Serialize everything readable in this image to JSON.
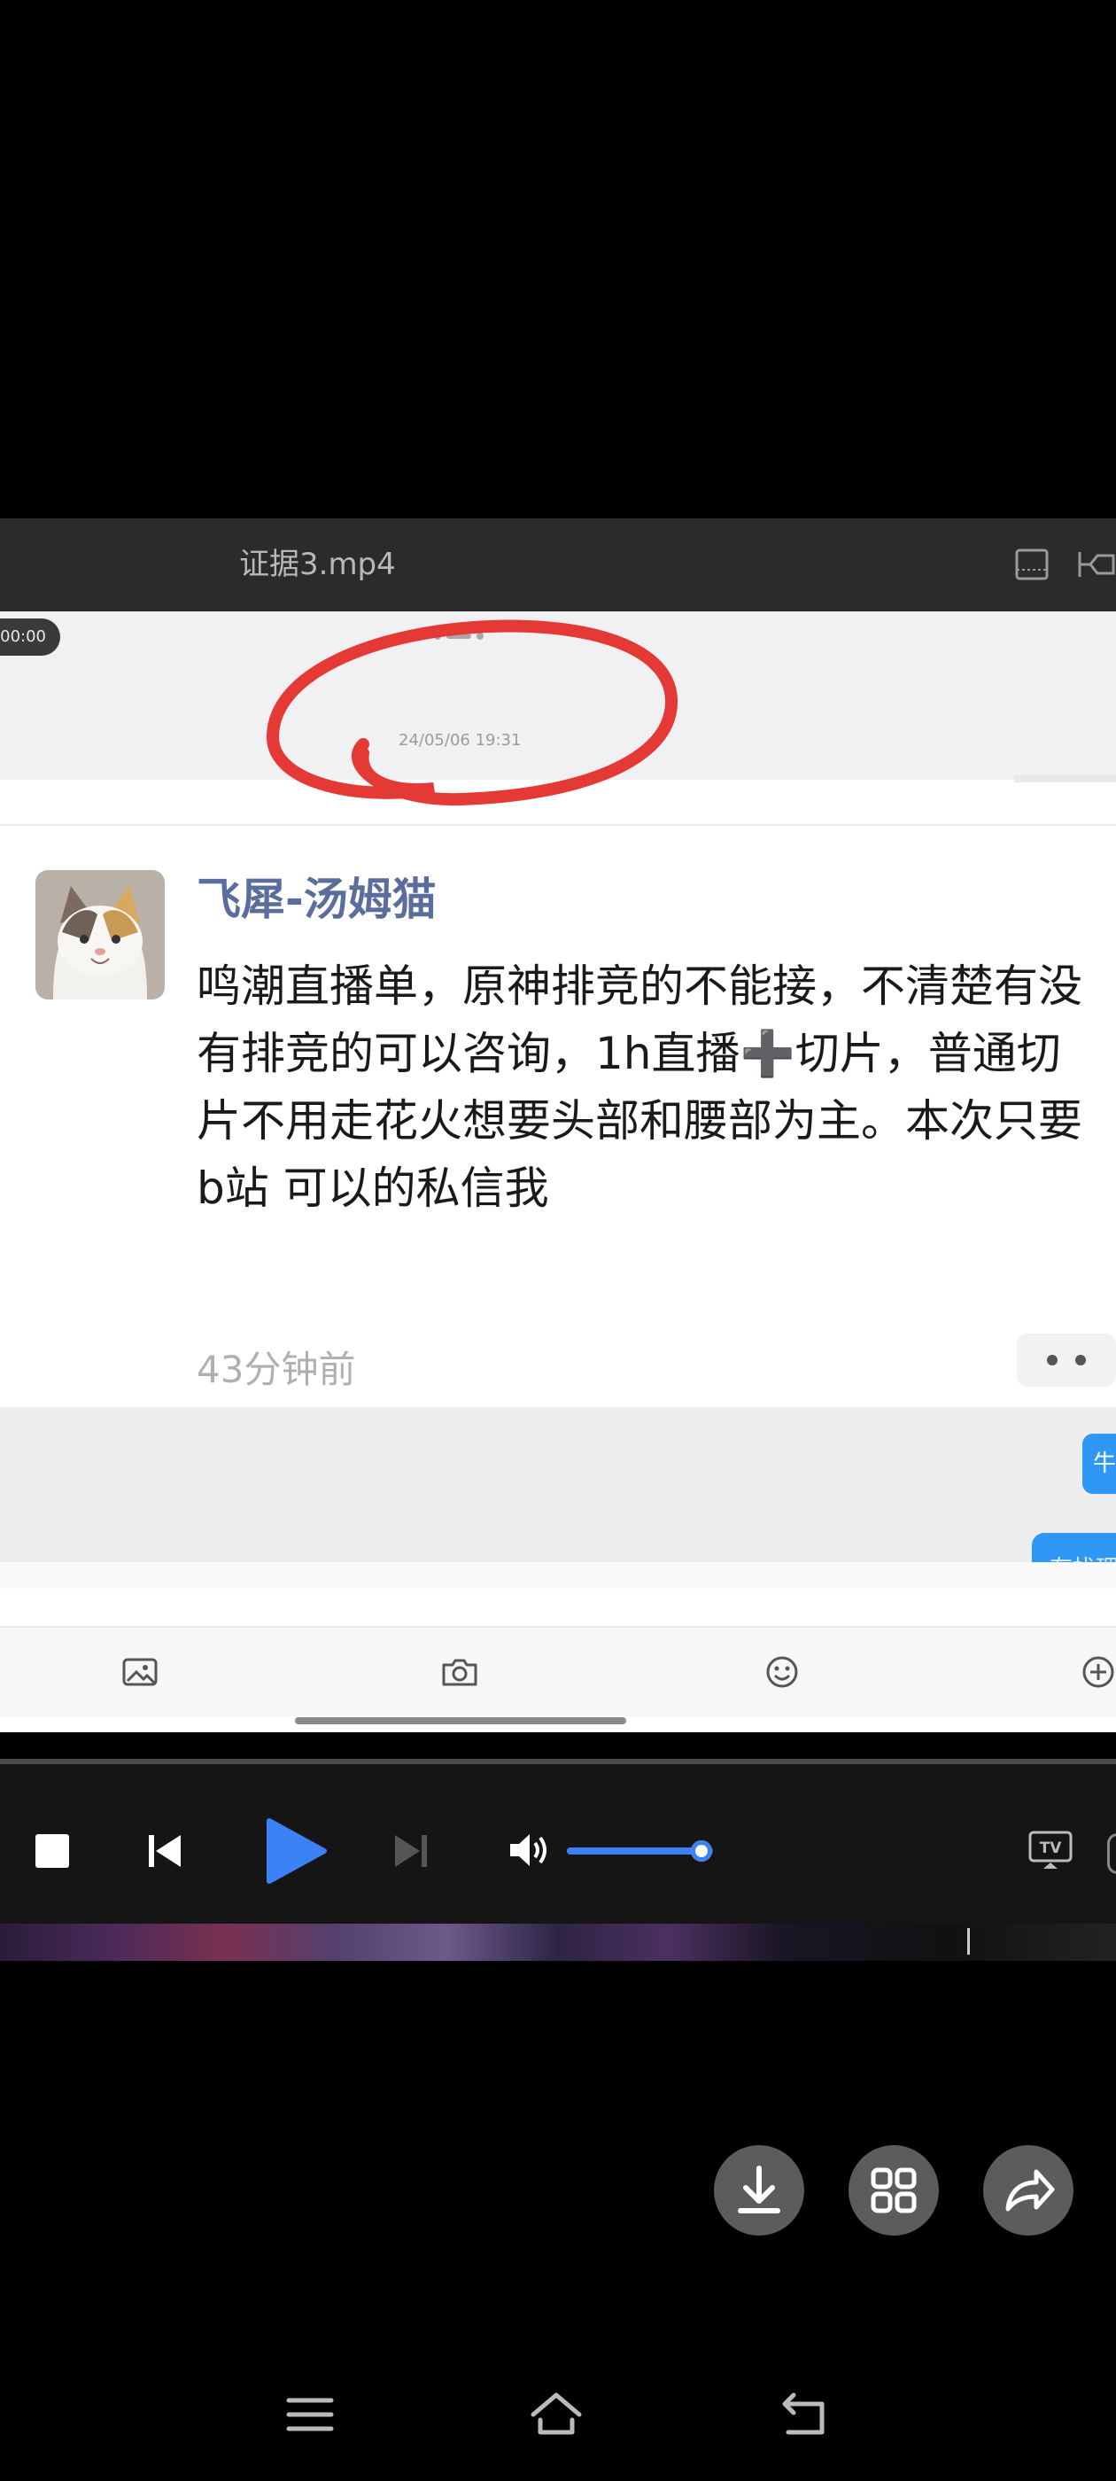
{
  "player": {
    "file_name": "证据3.mp4"
  },
  "video": {
    "recording_time": "00:00",
    "timestamp": "24/05/06 19:31",
    "post": {
      "username": "飞犀-汤姆猫",
      "message": "鸣潮直播单，原神排竞的不能接，不清楚有没有排竞的可以咨询，1h直播➕切片，普通切片不用走花火想要头部和腰部为主。本次只要b站 可以的私信我",
      "time_ago": "43分钟前"
    },
    "chat": {
      "bubble_1": "牛",
      "bubble_2": "有找理"
    }
  },
  "controls": {
    "volume_level": 0.92
  },
  "colors": {
    "accent_blue": "#3b82f6",
    "username_color": "#5a6d9c",
    "annotation_red": "#e53935"
  },
  "icons": [
    "fullscreen-icon",
    "pin-icon",
    "image-icon",
    "camera-icon",
    "emoji-icon",
    "plus-icon",
    "stop-icon",
    "previous-icon",
    "play-icon",
    "next-icon",
    "volume-icon",
    "tv-cast-icon",
    "download-icon",
    "grid-icon",
    "share-icon",
    "menu-icon",
    "home-icon",
    "back-icon"
  ]
}
